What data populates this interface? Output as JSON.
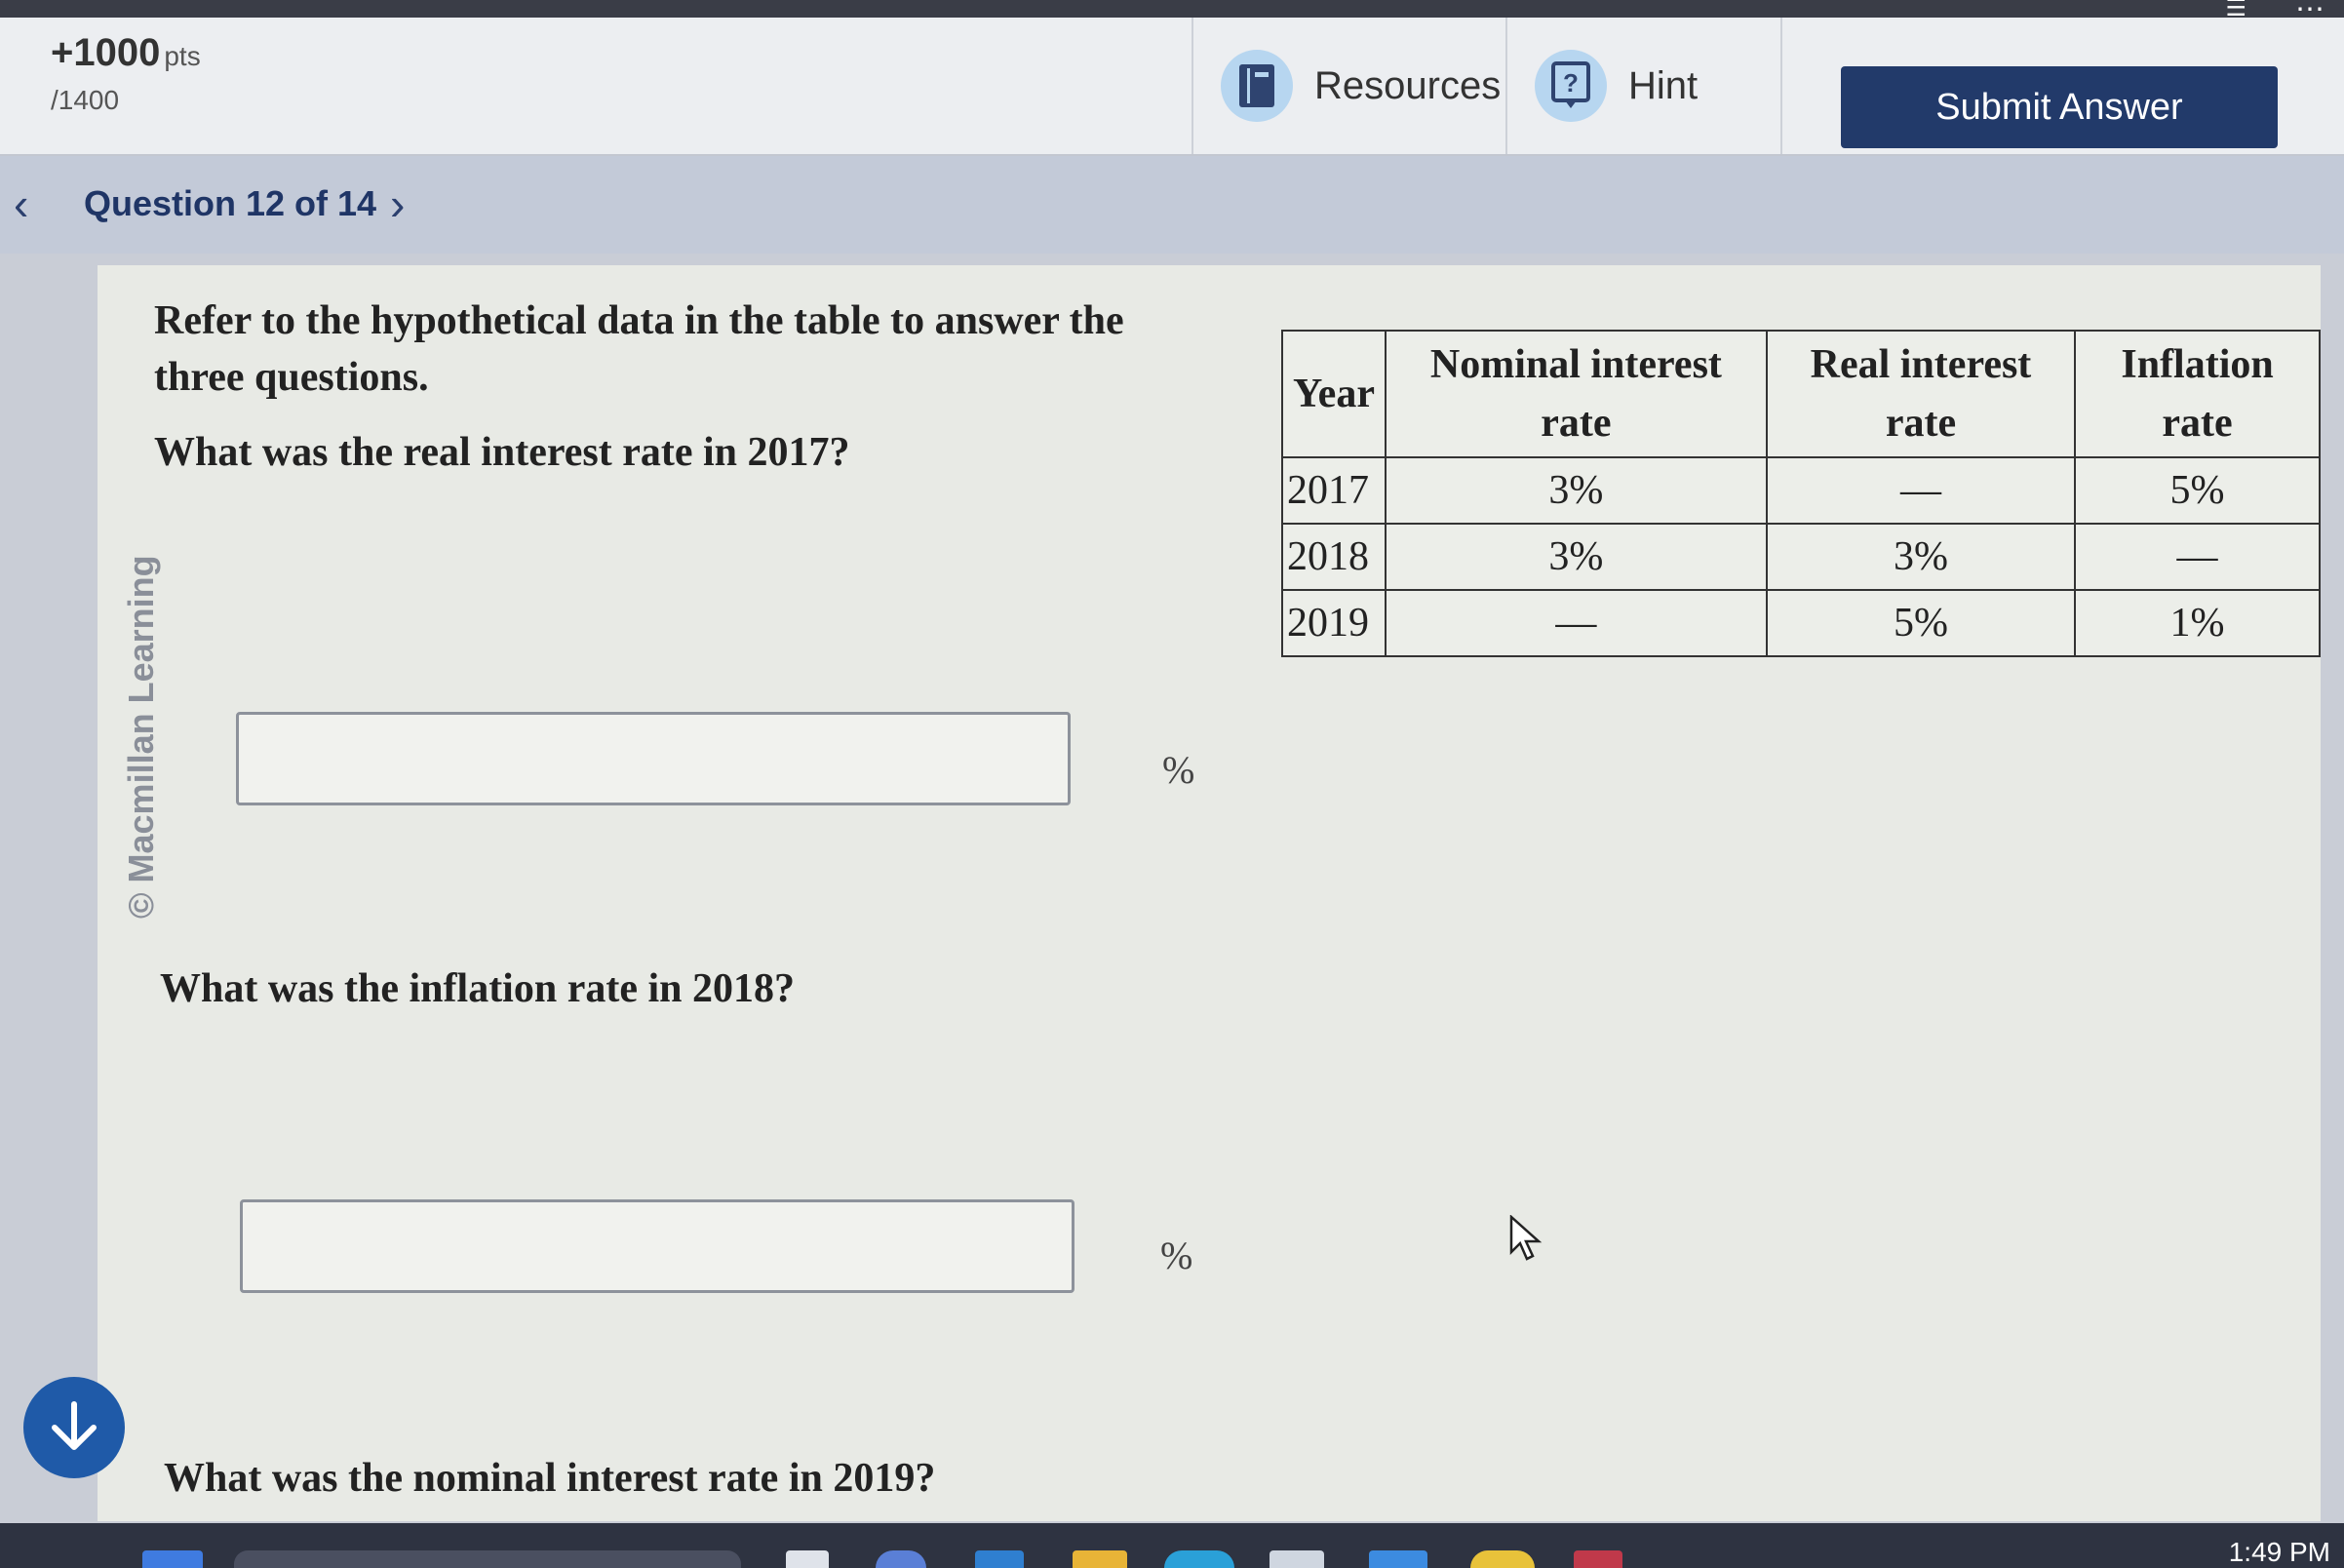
{
  "header": {
    "points_value": "+1000",
    "points_unit": "pts",
    "points_total": "/1400",
    "resources_label": "Resources",
    "hint_label": "Hint",
    "submit_label": "Submit Answer"
  },
  "nav": {
    "question_label": "Question 12 of 14",
    "prev_icon": "chevron-left-icon",
    "next_icon": "chevron-right-icon"
  },
  "sidebar": {
    "copyright": "© Macmillan Learning"
  },
  "question": {
    "intro": "Refer to the hypothetical data in the table to answer the three questions.",
    "q1": "What was the real interest rate in 2017?",
    "q2": "What was the inflation rate in 2018?",
    "q3": "What was the nominal interest rate in 2019?",
    "unit": "%",
    "answer1_value": "",
    "answer2_value": ""
  },
  "table": {
    "headers": [
      "Year",
      "Nominal interest rate",
      "Real interest rate",
      "Inflation rate"
    ],
    "rows": [
      [
        "2017",
        "3%",
        "—",
        "5%"
      ],
      [
        "2018",
        "3%",
        "3%",
        "—"
      ],
      [
        "2019",
        "—",
        "5%",
        "1%"
      ]
    ]
  },
  "taskbar": {
    "clock": "1:49 PM"
  },
  "colors": {
    "submit_bg": "#223a6a",
    "nav_text": "#1f3566",
    "icon_circle": "#b7d6f0",
    "scroll_button": "#1f5aa8"
  }
}
